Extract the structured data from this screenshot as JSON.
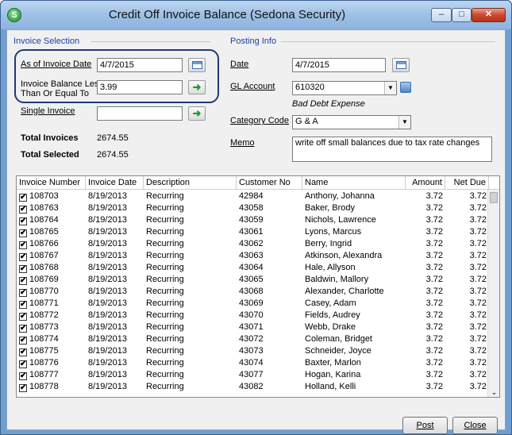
{
  "window": {
    "title": "Credit Off Invoice Balance (Sedona Security)",
    "app_icon_letter": "S",
    "controls": {
      "minimize": "–",
      "maximize": "□",
      "close": "✕"
    }
  },
  "invoice_selection": {
    "title": "Invoice Selection",
    "as_of_label": "As of Invoice Date",
    "as_of_value": "4/7/2015",
    "balance_label_1": "Invoice Balance Less",
    "balance_label_2": "Than Or Equal To",
    "balance_value": "3.99",
    "single_invoice_label": "Single Invoice",
    "single_invoice_value": "",
    "total_invoices_label": "Total Invoices",
    "total_invoices_value": "2674.55",
    "total_selected_label": "Total Selected",
    "total_selected_value": "2674.55"
  },
  "posting_info": {
    "title": "Posting Info",
    "date_label": "Date",
    "date_value": "4/7/2015",
    "gl_label": "GL Account",
    "gl_value": "610320",
    "gl_description": "Bad Debt Expense",
    "category_label": "Category Code",
    "category_value": "G & A",
    "memo_label": "Memo",
    "memo_value": "write off small balances due to tax rate changes"
  },
  "grid": {
    "columns": [
      "Invoice Number",
      "Invoice Date",
      "Description",
      "Customer No",
      "Name",
      "Amount",
      "Net Due"
    ],
    "rows": [
      {
        "invoice": "108703",
        "date": "8/19/2013",
        "desc": "Recurring",
        "cust": "42984",
        "name": "Anthony, Johanna",
        "amount": "3.72",
        "net": "3.72"
      },
      {
        "invoice": "108763",
        "date": "8/19/2013",
        "desc": "Recurring",
        "cust": "43058",
        "name": "Baker, Brody",
        "amount": "3.72",
        "net": "3.72"
      },
      {
        "invoice": "108764",
        "date": "8/19/2013",
        "desc": "Recurring",
        "cust": "43059",
        "name": "Nichols, Lawrence",
        "amount": "3.72",
        "net": "3.72"
      },
      {
        "invoice": "108765",
        "date": "8/19/2013",
        "desc": "Recurring",
        "cust": "43061",
        "name": "Lyons, Marcus",
        "amount": "3.72",
        "net": "3.72"
      },
      {
        "invoice": "108766",
        "date": "8/19/2013",
        "desc": "Recurring",
        "cust": "43062",
        "name": "Berry, Ingrid",
        "amount": "3.72",
        "net": "3.72"
      },
      {
        "invoice": "108767",
        "date": "8/19/2013",
        "desc": "Recurring",
        "cust": "43063",
        "name": "Atkinson, Alexandra",
        "amount": "3.72",
        "net": "3.72"
      },
      {
        "invoice": "108768",
        "date": "8/19/2013",
        "desc": "Recurring",
        "cust": "43064",
        "name": "Hale, Allyson",
        "amount": "3.72",
        "net": "3.72"
      },
      {
        "invoice": "108769",
        "date": "8/19/2013",
        "desc": "Recurring",
        "cust": "43065",
        "name": "Baldwin, Mallory",
        "amount": "3.72",
        "net": "3.72"
      },
      {
        "invoice": "108770",
        "date": "8/19/2013",
        "desc": "Recurring",
        "cust": "43068",
        "name": "Alexander, Charlotte",
        "amount": "3.72",
        "net": "3.72"
      },
      {
        "invoice": "108771",
        "date": "8/19/2013",
        "desc": "Recurring",
        "cust": "43069",
        "name": "Casey, Adam",
        "amount": "3.72",
        "net": "3.72"
      },
      {
        "invoice": "108772",
        "date": "8/19/2013",
        "desc": "Recurring",
        "cust": "43070",
        "name": "Fields, Audrey",
        "amount": "3.72",
        "net": "3.72"
      },
      {
        "invoice": "108773",
        "date": "8/19/2013",
        "desc": "Recurring",
        "cust": "43071",
        "name": "Webb, Drake",
        "amount": "3.72",
        "net": "3.72"
      },
      {
        "invoice": "108774",
        "date": "8/19/2013",
        "desc": "Recurring",
        "cust": "43072",
        "name": "Coleman, Bridget",
        "amount": "3.72",
        "net": "3.72"
      },
      {
        "invoice": "108775",
        "date": "8/19/2013",
        "desc": "Recurring",
        "cust": "43073",
        "name": "Schneider, Joyce",
        "amount": "3.72",
        "net": "3.72"
      },
      {
        "invoice": "108776",
        "date": "8/19/2013",
        "desc": "Recurring",
        "cust": "43074",
        "name": "Baxter, Marlon",
        "amount": "3.72",
        "net": "3.72"
      },
      {
        "invoice": "108777",
        "date": "8/19/2013",
        "desc": "Recurring",
        "cust": "43077",
        "name": "Hogan, Karina",
        "amount": "3.72",
        "net": "3.72"
      },
      {
        "invoice": "108778",
        "date": "8/19/2013",
        "desc": "Recurring",
        "cust": "43082",
        "name": "Holland, Kelli",
        "amount": "3.72",
        "net": "3.72"
      }
    ],
    "checked_mark": "✔"
  },
  "buttons": {
    "post": "Post",
    "close": "Close"
  }
}
